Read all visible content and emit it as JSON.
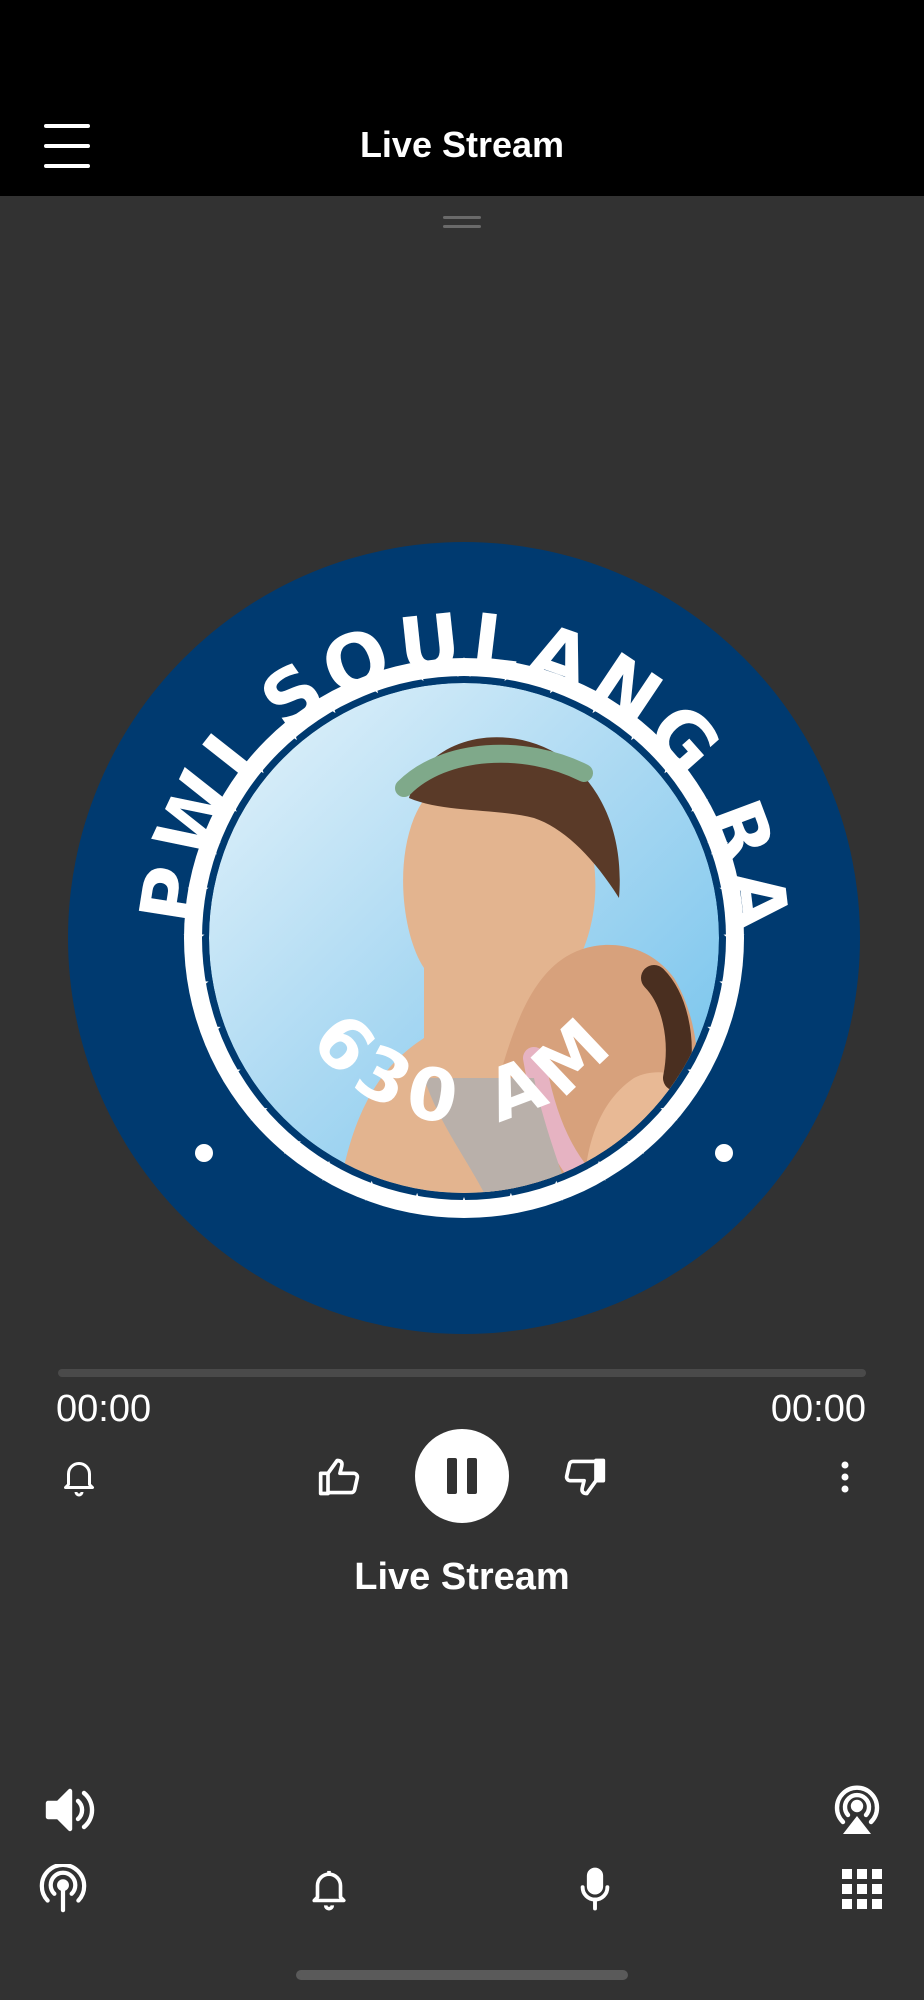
{
  "header": {
    "title": "Live Stream",
    "menu_icon": "hamburger-menu-icon"
  },
  "artwork": {
    "station_name": "PWIPWI SOULANG RADIO",
    "frequency": "630 AM",
    "colors": {
      "ring": "#003a70",
      "sky": "#a9d8f2",
      "skin": "#e3b48f"
    }
  },
  "player": {
    "elapsed": "00:00",
    "duration": "00:00",
    "progress": 0,
    "track_title": "Live Stream",
    "state": "playing"
  },
  "icons": {
    "alarm": "bell-icon",
    "like": "thumbs-up-icon",
    "pause": "pause-icon",
    "dislike": "thumbs-down-icon",
    "more": "more-vertical-icon",
    "volume": "volume-icon",
    "airplay": "airplay-icon",
    "tab_stream": "broadcast-icon",
    "tab_notifications": "bell-icon",
    "tab_podcasts": "microphone-icon",
    "tab_more": "grid-icon"
  }
}
